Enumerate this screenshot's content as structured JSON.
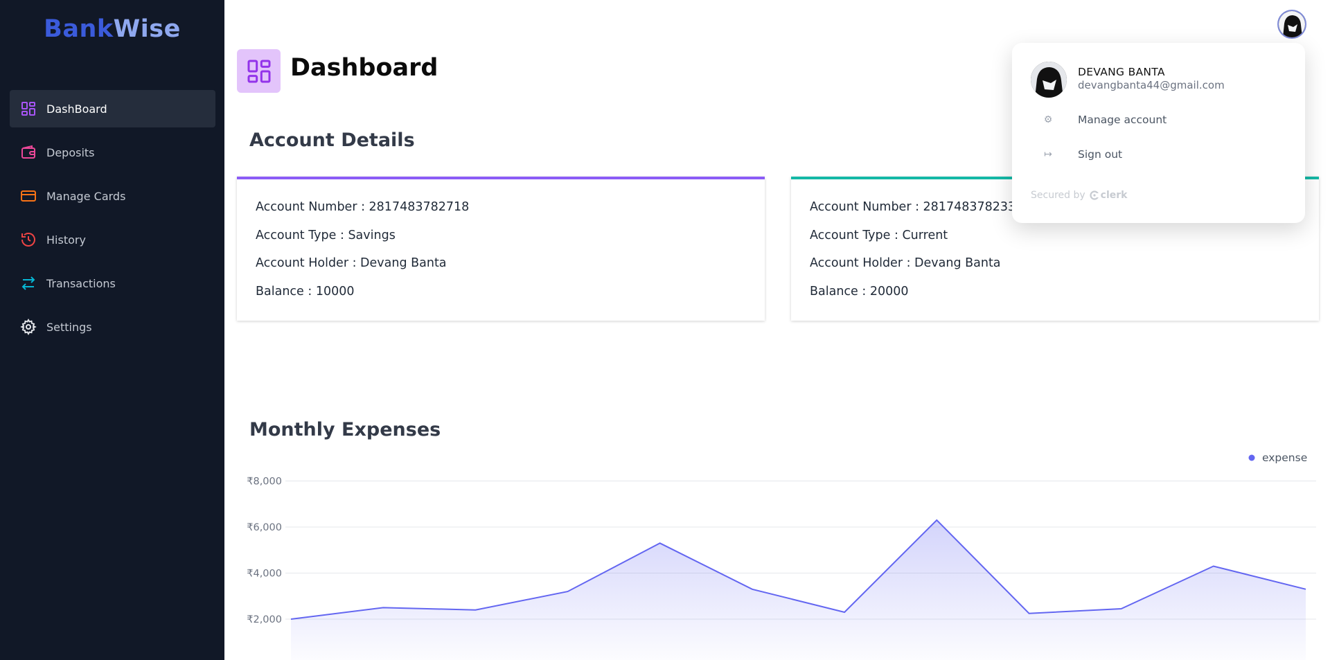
{
  "brand": {
    "part1": "Bank",
    "part2": "Wise"
  },
  "sidebar": {
    "items": [
      {
        "label": "DashBoard",
        "icon": "dashboard-icon",
        "color": "#a855f7",
        "active": true
      },
      {
        "label": "Deposits",
        "icon": "wallet-icon",
        "color": "#ec4899"
      },
      {
        "label": "Manage Cards",
        "icon": "credit-card-icon",
        "color": "#f97316"
      },
      {
        "label": "History",
        "icon": "history-icon",
        "color": "#ef4444"
      },
      {
        "label": "Transactions",
        "icon": "transfer-arrows-icon",
        "color": "#06b6d4"
      },
      {
        "label": "Settings",
        "icon": "gear-icon",
        "color": "#e5e7eb"
      }
    ]
  },
  "header": {
    "title": "Dashboard"
  },
  "accounts": {
    "title": "Account Details",
    "cards": [
      {
        "number": "Account Number : 2817483782718",
        "type": "Account Type : Savings",
        "holder": "Account Holder : Devang Banta",
        "balance": "Balance : 10000",
        "accent": "#8b5cf6"
      },
      {
        "number": "Account Number : 2817483782333",
        "type": "Account Type : Current",
        "holder": "Account Holder : Devang Banta",
        "balance": "Balance : 20000",
        "accent": "#14b8a6"
      }
    ]
  },
  "expenses": {
    "title": "Monthly Expenses"
  },
  "chart_data": {
    "type": "area",
    "series": [
      {
        "name": "expense",
        "color": "#6366f1",
        "values": [
          2000,
          2500,
          2400,
          3200,
          5300,
          3300,
          2300,
          6300,
          2250,
          2450,
          4300,
          3300
        ]
      }
    ],
    "yticks": [
      "₹2,000",
      "₹4,000",
      "₹6,000",
      "₹8,000"
    ],
    "ylim": [
      0,
      8000
    ],
    "grid": true,
    "legend": "top-right"
  },
  "user_menu": {
    "name": "DEVANG BANTA",
    "email": "devangbanta44@gmail.com",
    "manage": "Manage account",
    "signout": "Sign out",
    "secured_by": "Secured by",
    "provider": "clerk"
  }
}
